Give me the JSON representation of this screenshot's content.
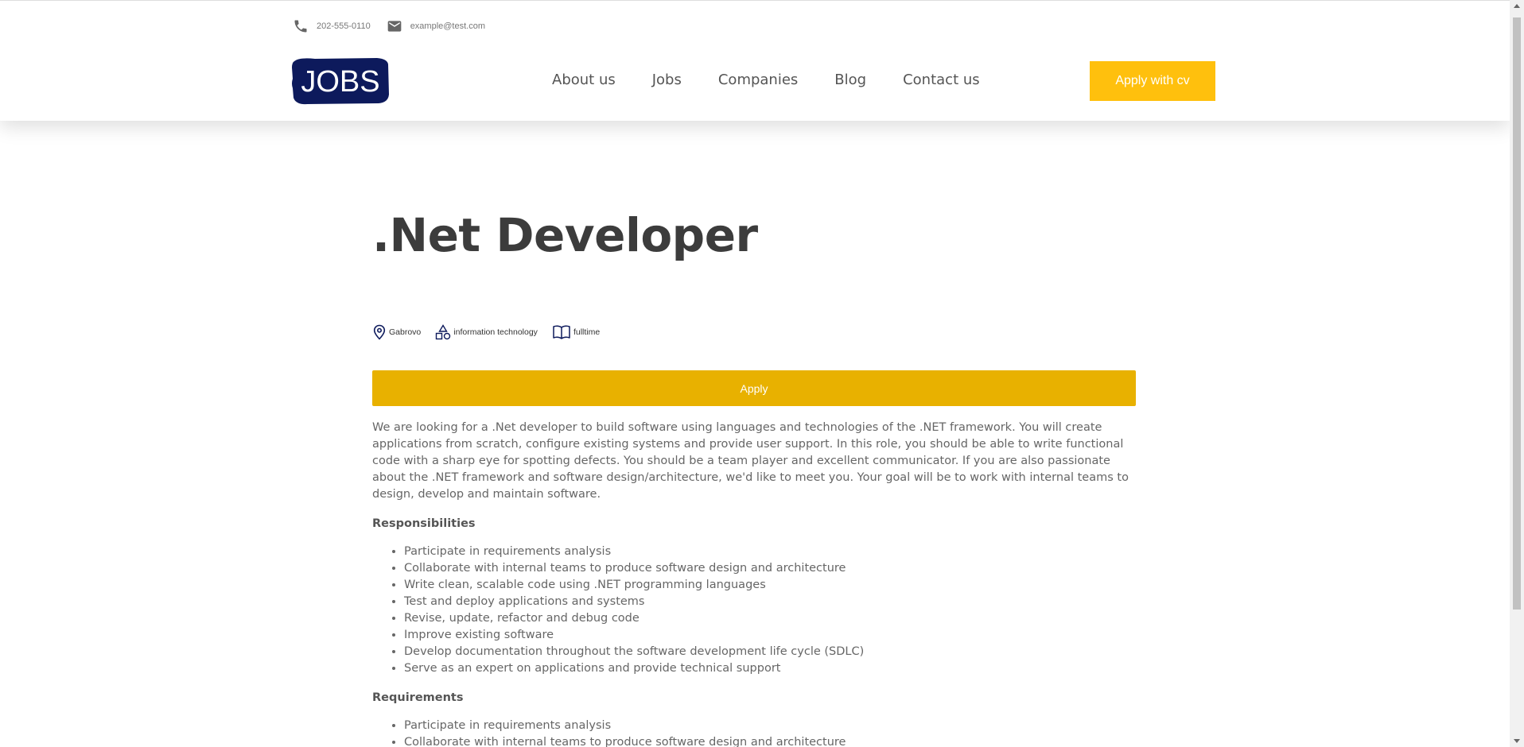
{
  "header": {
    "phone": "202-555-0110",
    "email": "example@test.com",
    "logo_text": "JOBS",
    "nav": [
      {
        "label": "About us"
      },
      {
        "label": "Jobs"
      },
      {
        "label": "Companies"
      },
      {
        "label": "Blog"
      },
      {
        "label": "Contact us"
      }
    ],
    "apply_cv_label": "Apply with cv"
  },
  "job": {
    "title": ".Net Developer",
    "location": "Gabrovo",
    "category": "information technology",
    "type": "fulltime",
    "apply_label": "Apply",
    "description": "We are looking for a .Net developer to build software using languages and technologies of the .NET framework. You will create applications from scratch, configure existing systems and provide user support. In this role, you should be able to write functional code with a sharp eye for spotting defects. You should be a team player and excellent communicator. If you are also passionate about the .NET framework and software design/architecture, we'd like to meet you. Your goal will be to work with internal teams to design, develop and maintain software.",
    "responsibilities_heading": "Responsibilities",
    "responsibilities": [
      "Participate in requirements analysis",
      "Collaborate with internal teams to produce software design and architecture",
      "Write clean, scalable code using .NET programming languages",
      "Test and deploy applications and systems",
      "Revise, update, refactor and debug code",
      "Improve existing software",
      "Develop documentation throughout the software development life cycle (SDLC)",
      "Serve as an expert on applications and provide technical support"
    ],
    "requirements_heading": "Requirements",
    "requirements": [
      "Participate in requirements analysis",
      "Collaborate with internal teams to produce software design and architecture"
    ]
  },
  "colors": {
    "accent": "#ffc00d",
    "apply_button": "#e8b100",
    "logo_bg": "#0d1a5c"
  },
  "icons": {
    "phone": "phone-icon",
    "email": "mail-icon",
    "location": "map-pin-icon",
    "category": "shapes-icon",
    "type": "book-icon"
  }
}
